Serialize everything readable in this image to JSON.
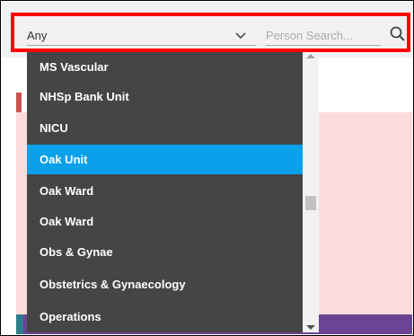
{
  "filter": {
    "selected_value": "Any",
    "search_placeholder": "Person Search..."
  },
  "dropdown": {
    "options": [
      "MS Vascular",
      "NHSp Bank Unit",
      "NICU",
      "Oak Unit",
      "Oak Ward",
      "Oak Ward",
      "Obs & Gynae",
      "Obstetrics & Gynaecology",
      "Operations"
    ],
    "selected_index": 3
  },
  "colors": {
    "highlight": "#ff0000",
    "selected_option": "#0aa0ea",
    "dropdown_bg": "#454545",
    "background_pink": "#fbdcdc",
    "bottom_bar": "#6a4495"
  },
  "icons": {
    "chevron": "chevron-down-icon",
    "search": "search-icon"
  }
}
